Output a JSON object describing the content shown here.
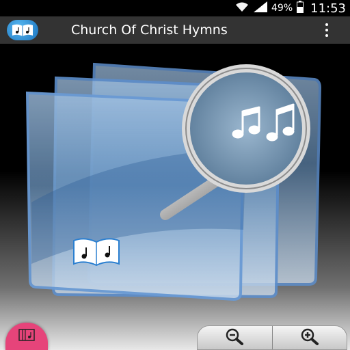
{
  "status": {
    "battery_percent": "49%",
    "clock": "11:53"
  },
  "app_bar": {
    "title": "Church Of Christ Hymns",
    "logo_icon": "hymn-book-logo-icon",
    "menu_icon": "overflow-menu-icon"
  },
  "hero": {
    "image": "hymn-search-illustration",
    "magnifier_icon": "music-notes-magnifier-icon",
    "book_icon": "hymn-book-icon"
  },
  "bottom": {
    "fab_icon": "music-library-icon",
    "fab_color": "#e6447a",
    "zoom_out_icon": "zoom-out-icon",
    "zoom_in_icon": "zoom-in-icon"
  }
}
